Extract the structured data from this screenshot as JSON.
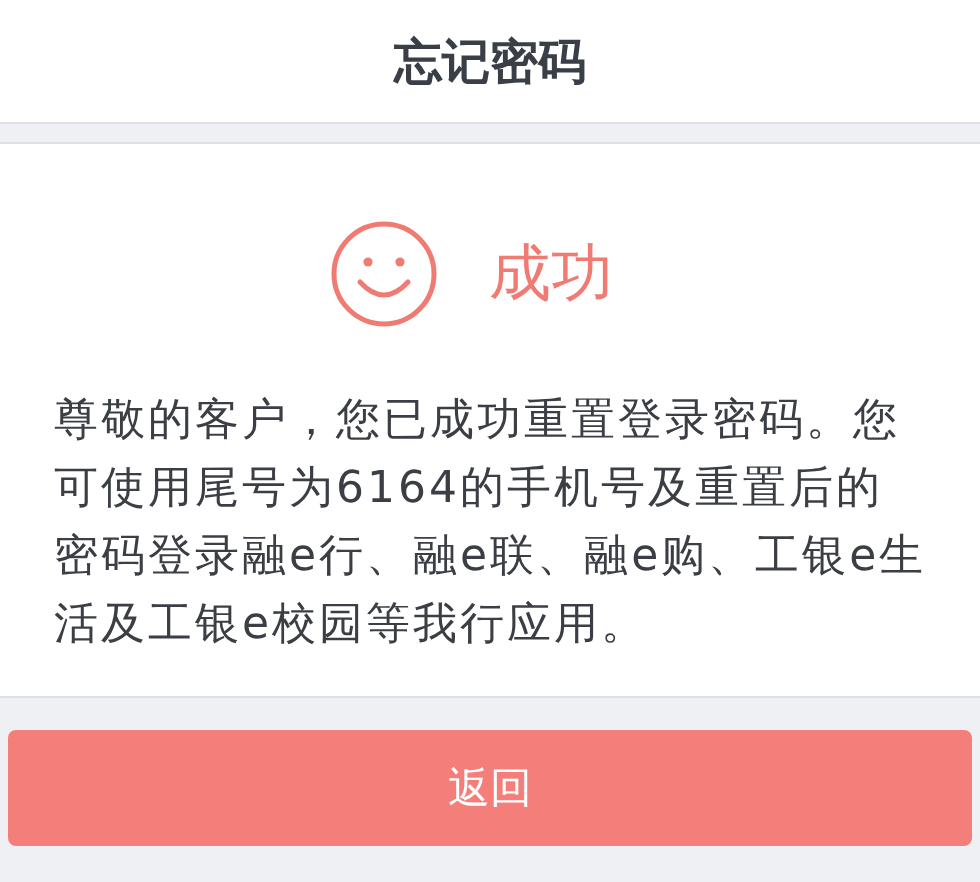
{
  "header": {
    "title": "忘记密码"
  },
  "result": {
    "status": "成功",
    "message": "尊敬的客户，您已成功重置登录密码。您可使用尾号为6164的手机号及重置后的密码登录融e行、融e联、融e购、工银e生活及工银e校园等我行应用。"
  },
  "button": {
    "label": "返回"
  }
}
